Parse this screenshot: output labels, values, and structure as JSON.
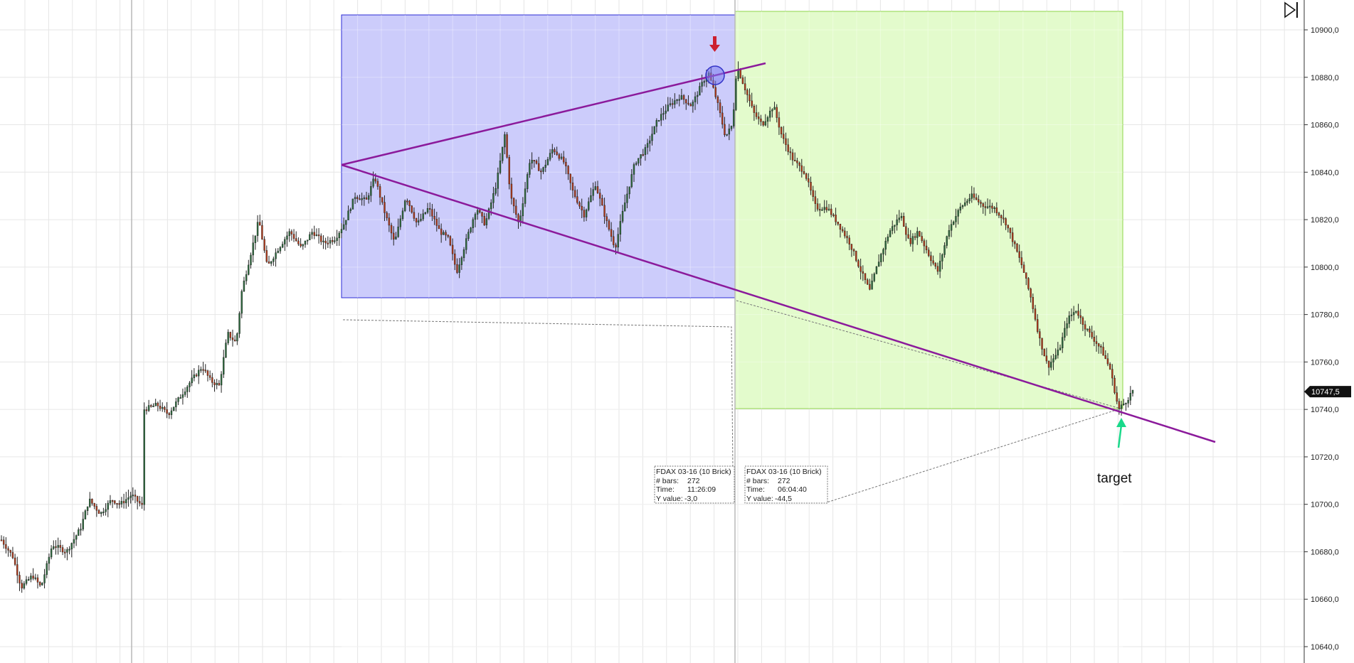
{
  "chart_data": {
    "type": "candlestick",
    "instrument": "FDAX 03-16 (10 Brick)",
    "ylim": [
      10632,
      10910
    ],
    "y_ticks": [
      "10900,0",
      "10880,0",
      "10860,0",
      "10840,0",
      "10820,0",
      "10800,0",
      "10780,0",
      "10760,0",
      "10740,0",
      "10720,0",
      "10700,0",
      "10680,0",
      "10660,0",
      "10640,0"
    ],
    "y_tick_values": [
      10900,
      10880,
      10860,
      10840,
      10820,
      10800,
      10780,
      10760,
      10740,
      10720,
      10700,
      10680,
      10660,
      10640
    ],
    "grid": true,
    "last_price": "10747,5",
    "bar_count": 500,
    "waypoints": [
      [
        0,
        10685
      ],
      [
        8,
        10678
      ],
      [
        14,
        10665
      ],
      [
        22,
        10670
      ],
      [
        28,
        10665
      ],
      [
        36,
        10683
      ],
      [
        46,
        10680
      ],
      [
        56,
        10690
      ],
      [
        62,
        10702
      ],
      [
        70,
        10696
      ],
      [
        78,
        10702
      ],
      [
        84,
        10700
      ],
      [
        92,
        10704
      ],
      [
        100,
        10699
      ],
      [
        101,
        10740
      ],
      [
        110,
        10742
      ],
      [
        118,
        10738
      ],
      [
        126,
        10745
      ],
      [
        134,
        10752
      ],
      [
        142,
        10758
      ],
      [
        148,
        10752
      ],
      [
        154,
        10750
      ],
      [
        160,
        10772
      ],
      [
        166,
        10768
      ],
      [
        170,
        10790
      ],
      [
        176,
        10805
      ],
      [
        182,
        10820
      ],
      [
        188,
        10800
      ],
      [
        196,
        10808
      ],
      [
        204,
        10815
      ],
      [
        212,
        10808
      ],
      [
        220,
        10815
      ],
      [
        228,
        10810
      ],
      [
        236,
        10812
      ],
      [
        242,
        10818
      ],
      [
        250,
        10830
      ],
      [
        258,
        10828
      ],
      [
        264,
        10838
      ],
      [
        270,
        10825
      ],
      [
        278,
        10810
      ],
      [
        286,
        10830
      ],
      [
        294,
        10818
      ],
      [
        302,
        10825
      ],
      [
        310,
        10815
      ],
      [
        316,
        10812
      ],
      [
        322,
        10798
      ],
      [
        328,
        10810
      ],
      [
        336,
        10825
      ],
      [
        342,
        10818
      ],
      [
        350,
        10835
      ],
      [
        356,
        10856
      ],
      [
        360,
        10830
      ],
      [
        366,
        10818
      ],
      [
        374,
        10846
      ],
      [
        382,
        10840
      ],
      [
        390,
        10850
      ],
      [
        398,
        10844
      ],
      [
        404,
        10832
      ],
      [
        412,
        10822
      ],
      [
        420,
        10835
      ],
      [
        428,
        10819
      ],
      [
        434,
        10808
      ],
      [
        440,
        10825
      ],
      [
        448,
        10844
      ],
      [
        456,
        10850
      ],
      [
        464,
        10862
      ],
      [
        472,
        10868
      ],
      [
        480,
        10872
      ],
      [
        488,
        10868
      ],
      [
        496,
        10878
      ],
      [
        500,
        10882
      ],
      [
        506,
        10870
      ],
      [
        512,
        10855
      ],
      [
        517,
        10860
      ],
      [
        520,
        10885
      ],
      [
        526,
        10875
      ],
      [
        532,
        10865
      ],
      [
        538,
        10860
      ],
      [
        546,
        10868
      ],
      [
        552,
        10855
      ],
      [
        560,
        10845
      ],
      [
        568,
        10840
      ],
      [
        576,
        10825
      ],
      [
        584,
        10825
      ],
      [
        592,
        10818
      ],
      [
        600,
        10810
      ],
      [
        608,
        10798
      ],
      [
        614,
        10790
      ],
      [
        620,
        10802
      ],
      [
        628,
        10815
      ],
      [
        636,
        10822
      ],
      [
        642,
        10810
      ],
      [
        648,
        10815
      ],
      [
        656,
        10805
      ],
      [
        662,
        10798
      ],
      [
        670,
        10816
      ],
      [
        678,
        10825
      ],
      [
        686,
        10830
      ],
      [
        694,
        10826
      ],
      [
        702,
        10825
      ],
      [
        710,
        10819
      ],
      [
        716,
        10810
      ],
      [
        722,
        10800
      ],
      [
        728,
        10787
      ],
      [
        734,
        10770
      ],
      [
        740,
        10758
      ],
      [
        748,
        10765
      ],
      [
        754,
        10778
      ],
      [
        760,
        10782
      ],
      [
        766,
        10775
      ],
      [
        772,
        10770
      ],
      [
        778,
        10765
      ],
      [
        784,
        10757
      ],
      [
        790,
        10740
      ],
      [
        796,
        10744
      ],
      [
        800,
        10748
      ]
    ]
  },
  "annotations": {
    "info_boxes": [
      {
        "title": "FDAX 03-16 (10 Brick)",
        "bars_label": "# bars:",
        "bars_value": "272",
        "time_label": "Time:",
        "time_value": "11:26:09",
        "y_label": "Y value:",
        "y_value": "-3,0"
      },
      {
        "title": "FDAX 03-16 (10 Brick)",
        "bars_label": "# bars:",
        "bars_value": "272",
        "time_label": "Time:",
        "time_value": "06:04:40",
        "y_label": "Y value:",
        "y_value": "-44,5"
      }
    ],
    "target_label": "target"
  },
  "colors": {
    "blue_zone_fill": "#c9c9fb",
    "blue_zone_border": "#2b2bd6",
    "green_zone_fill": "#e1fbc9",
    "green_zone_border": "#8fd54a",
    "trendline": "#8b1a9b",
    "up_candle": "#2f6b3f",
    "down_candle": "#b23a1a",
    "wick": "#222222",
    "arrow_down": "#cc1f2f",
    "arrow_up": "#19d98a",
    "grid": "#e6e6e6"
  },
  "icons": {
    "scroll_end": "skip-to-end-icon"
  }
}
